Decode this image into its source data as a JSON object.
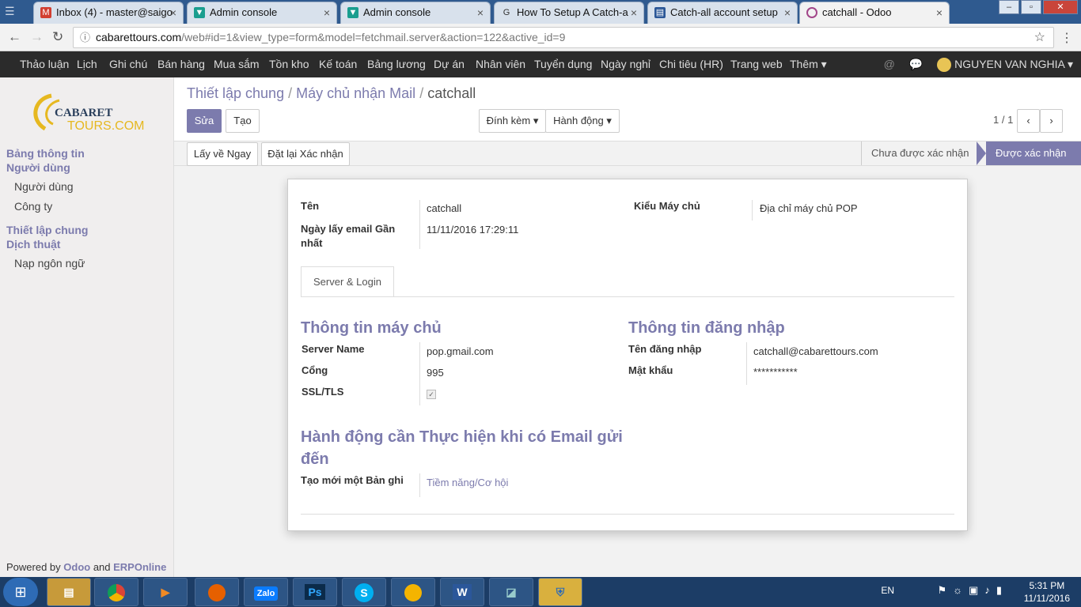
{
  "browser": {
    "tabs": [
      {
        "title": "Inbox (4) - master@saigo",
        "icon": "gmail-icon",
        "color": "#d23f31"
      },
      {
        "title": "Admin console",
        "icon": "google-admin-icon",
        "color": "#1a9e8f"
      },
      {
        "title": "Admin console",
        "icon": "google-admin-icon",
        "color": "#1a9e8f"
      },
      {
        "title": "How To Setup A Catch-a",
        "icon": "g-icon",
        "color": "#555555"
      },
      {
        "title": "Catch-all account setup",
        "icon": "doc-icon",
        "color": "#2b5797"
      },
      {
        "title": "catchall - Odoo",
        "icon": "odoo-icon",
        "color": "#a24689"
      }
    ],
    "url_domain": "cabarettours.com",
    "url_path": "/web#id=1&view_type=form&model=fetchmail.server&action=122&active_id=9"
  },
  "topnav": {
    "items": [
      "Thảo luận",
      "Lịch",
      "Ghi chú",
      "Bán hàng",
      "Mua sắm",
      "Tồn kho",
      "Kế toán",
      "Bảng lương",
      "Dự án",
      "Nhân viên",
      "Tuyển dụng",
      "Ngày nghỉ",
      "Chi tiêu (HR)",
      "Trang web",
      "Thêm ▾"
    ],
    "user": "NGUYEN VAN NGHIA"
  },
  "sidebar": {
    "logo_line1": "CABARET",
    "logo_line2": "TOURS.COM",
    "sections": [
      {
        "label": "Bảng thông tin"
      },
      {
        "label": "Người dùng"
      },
      {
        "label": "Thiết lập chung"
      },
      {
        "label": "Dịch thuật"
      }
    ],
    "items": [
      "Người dùng",
      "Công ty",
      "Nạp ngôn ngữ"
    ],
    "powered_prefix": "Powered by ",
    "powered_odoo": "Odoo",
    "powered_and": " and ",
    "powered_erp": "ERPOnline"
  },
  "control_panel": {
    "breadcrumb": [
      "Thiết lập chung",
      "Máy chủ nhận Mail",
      "catchall"
    ],
    "edit_label": "Sửa",
    "create_label": "Tạo",
    "attach_label": "Đính kèm ▾",
    "action_label": "Hành động ▾",
    "pager": "1 / 1"
  },
  "statusbar": {
    "fetch_label": "Lấy về Ngay",
    "reset_label": "Đặt lại Xác nhận",
    "stages": [
      "Chưa được xác nhận",
      "Được xác nhận"
    ],
    "active_stage": "Được xác nhận"
  },
  "form": {
    "name_label": "Tên",
    "name_value": "catchall",
    "date_label": "Ngày lấy email Gần nhất",
    "date_value": "11/11/2016 17:29:11",
    "type_label": "Kiểu Máy chủ",
    "type_value": "Địa chỉ máy chủ POP",
    "tab_label": "Server & Login",
    "server_section": "Thông tin máy chủ",
    "login_section": "Thông tin đăng nhập",
    "server_name_label": "Server Name",
    "server_name_value": "pop.gmail.com",
    "port_label": "Cổng",
    "port_value": "995",
    "ssl_label": "SSL/TLS",
    "ssl_checked": true,
    "username_label": "Tên đăng nhập",
    "username_value": "catchall@cabarettours.com",
    "password_label": "Mật khẩu",
    "password_value": "***********",
    "action_section": "Hành động cần Thực hiện khi có Email gửi đến",
    "create_record_label": "Tạo mới một Bản ghi",
    "create_record_value": "Tiềm năng/Cơ hội"
  },
  "taskbar": {
    "apps": [
      "explorer-icon",
      "chrome-icon",
      "media-player-icon",
      "firefox-icon",
      "zalo-icon",
      "photoshop-icon",
      "skype-icon",
      "chrome-canary-icon",
      "word-icon",
      "paint-icon",
      "security-shield-icon"
    ],
    "zalo_text": "Zalo",
    "ps_text": "Ps",
    "word_text": "W",
    "lang": "EN",
    "time": "5:31 PM",
    "date": "11/11/2016"
  },
  "colors": {
    "accent": "#7c7bad",
    "topnav": "#2b2b2b",
    "taskbar": "#1c3d66"
  }
}
